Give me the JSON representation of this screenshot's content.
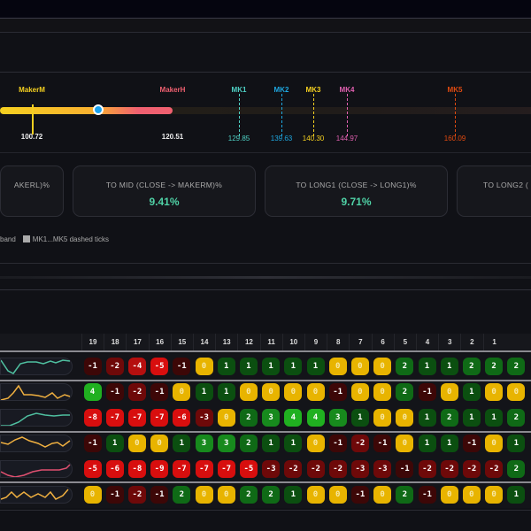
{
  "band": {
    "makers": [
      {
        "name": "MakerM",
        "value": "100.72",
        "color": "#f5d020"
      },
      {
        "name": "MakerH",
        "value": "120.51",
        "color": "#f06070"
      }
    ],
    "ticks": [
      {
        "name": "MK1",
        "value": "129.85",
        "color": "#4fd1c5"
      },
      {
        "name": "MK2",
        "value": "139.63",
        "color": "#1ea7e0"
      },
      {
        "name": "MK3",
        "value": "140.30",
        "color": "#f5d020"
      },
      {
        "name": "MK4",
        "value": "144.97",
        "color": "#e060b0"
      },
      {
        "name": "MK5",
        "value": "160.09",
        "color": "#e04a10"
      }
    ]
  },
  "cards": [
    {
      "title": "AKERL)%",
      "value": ""
    },
    {
      "title": "TO MID (CLOSE -> MAKERM)%",
      "value": "9.41%"
    },
    {
      "title": "TO LONG1 (CLOSE -> LONG1)%",
      "value": "9.71%"
    },
    {
      "title": "TO LONG2 (",
      "value": ""
    }
  ],
  "legend": {
    "band": "band",
    "ticks": "MK1...MK5 dashed ticks"
  },
  "table": {
    "columns": [
      "19",
      "18",
      "17",
      "16",
      "15",
      "14",
      "13",
      "12",
      "11",
      "10",
      "9",
      "8",
      "7",
      "6",
      "5",
      "4",
      "3",
      "2",
      "1"
    ],
    "rows": [
      [
        -1,
        -2,
        -4,
        -5,
        -1,
        0,
        1,
        1,
        1,
        1,
        1,
        0,
        0,
        0,
        2,
        1,
        1,
        2,
        2,
        2
      ],
      [
        4,
        -1,
        -2,
        -1,
        0,
        1,
        1,
        0,
        0,
        0,
        0,
        -1,
        0,
        0,
        2,
        -1,
        0,
        1,
        0,
        0
      ],
      [
        -8,
        -7,
        -7,
        -7,
        -6,
        -3,
        0,
        2,
        3,
        4,
        4,
        3,
        1,
        0,
        0,
        1,
        2,
        1,
        1,
        2
      ],
      [
        -1,
        1,
        0,
        0,
        1,
        3,
        3,
        2,
        1,
        1,
        0,
        -1,
        -2,
        -1,
        0,
        1,
        1,
        -1,
        0,
        1
      ],
      [
        -5,
        -6,
        -8,
        -9,
        -7,
        -7,
        -7,
        -5,
        -3,
        -2,
        -2,
        -2,
        -3,
        -3,
        -1,
        -2,
        -2,
        -2,
        -2,
        2
      ],
      [
        0,
        -1,
        -2,
        -1,
        2,
        0,
        0,
        2,
        2,
        1,
        0,
        0,
        -1,
        0,
        2,
        -1,
        0,
        0,
        0,
        1
      ]
    ]
  }
}
